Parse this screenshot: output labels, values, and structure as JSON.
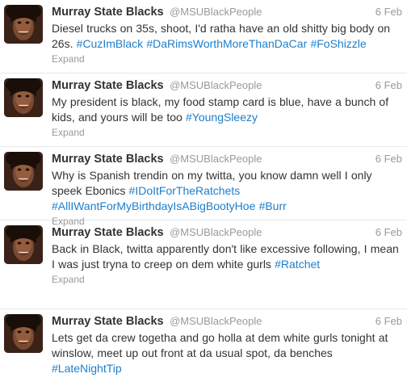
{
  "colors": {
    "hashtag": "#1e7ec9",
    "name": "#333333",
    "meta": "#999999"
  },
  "tweets": [
    {
      "avatar_icon": "profile-photo",
      "name": "Murray State Blacks",
      "handle": "@MSUBlackPeople",
      "time": "6 Feb",
      "segments": [
        {
          "t": "Diesel trucks on 35s, shoot, I'd ratha have an old shitty big body on 26s. "
        },
        {
          "t": "#CuzImBlack",
          "tag": true
        },
        {
          "t": " "
        },
        {
          "t": "#DaRimsWorthMoreThanDaCar",
          "tag": true
        },
        {
          "t": " "
        },
        {
          "t": "#FoShizzle",
          "tag": true
        }
      ],
      "expand": "Expand"
    },
    {
      "avatar_icon": "profile-photo",
      "name": "Murray State Blacks",
      "handle": "@MSUBlackPeople",
      "time": "6 Feb",
      "segments": [
        {
          "t": "My president is black, my food stamp card is blue, have a bunch of kids, and yours will be too "
        },
        {
          "t": "#YoungSleezy",
          "tag": true
        }
      ],
      "expand": "Expand"
    },
    {
      "avatar_icon": "profile-photo",
      "name": "Murray State Blacks",
      "handle": "@MSUBlackPeople",
      "time": "6 Feb",
      "segments": [
        {
          "t": "Why is Spanish trendin on my twitta, you know damn well I only speek Ebonics "
        },
        {
          "t": "#IDoItForTheRatchets",
          "tag": true
        },
        {
          "t": " "
        },
        {
          "t": "#AllIWantForMyBirthdayIsABigBootyHoe",
          "tag": true
        },
        {
          "t": " "
        },
        {
          "t": "#Burr",
          "tag": true
        }
      ],
      "expand": "Expand"
    },
    {
      "avatar_icon": "profile-photo",
      "name": "Murray State Blacks",
      "handle": "@MSUBlackPeople",
      "time": "6 Feb",
      "segments": [
        {
          "t": "Back in Black, twitta apparently don't like excessive following, I mean I was just tryna to creep on dem white gurls "
        },
        {
          "t": "#Ratchet",
          "tag": true
        }
      ],
      "expand": "Expand"
    },
    {
      "avatar_icon": "profile-photo",
      "name": "Murray State Blacks",
      "handle": "@MSUBlackPeople",
      "time": "6 Feb",
      "segments": [
        {
          "t": "Lets get da crew togetha and go holla at dem white gurls tonight at winslow, meet up out front at da usual spot, da benches "
        },
        {
          "t": "#LateNightTip",
          "tag": true
        }
      ],
      "expand": ""
    }
  ]
}
